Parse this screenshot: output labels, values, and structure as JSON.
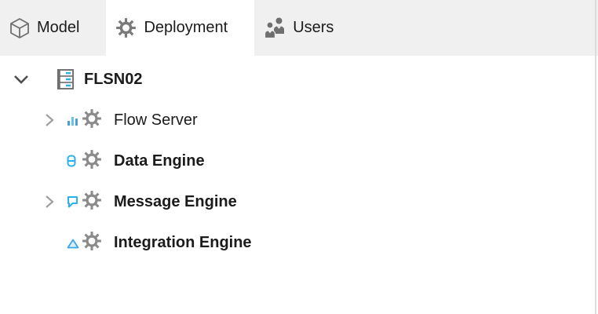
{
  "tab_bar": {
    "tabs": [
      {
        "label": "Model",
        "icon": "cube-icon",
        "active": false
      },
      {
        "label": "Deployment",
        "icon": "gear-icon",
        "active": true
      },
      {
        "label": "Users",
        "icon": "users-icon",
        "active": false
      }
    ]
  },
  "tree": {
    "root": {
      "label": "FLSN02",
      "icon": "server-icon",
      "state": "expanded"
    },
    "children": [
      {
        "label": "Flow Server",
        "icon": "flow-stats-gear-icon",
        "state": "collapsed"
      },
      {
        "label": "Data Engine",
        "icon": "database-gear-icon",
        "state": "leaf"
      },
      {
        "label": "Message Engine",
        "icon": "message-gear-icon",
        "state": "collapsed"
      },
      {
        "label": "Integration Engine",
        "icon": "integration-gear-icon",
        "state": "leaf"
      }
    ]
  },
  "colors": {
    "tab_bar_bg": "#f0f0f0",
    "active_tab_bg": "#ffffff",
    "text": "#1b1b1b",
    "accent_blue": "#2fb0e8",
    "icon_gray": "#6f6f6f",
    "gear_gray": "#848484"
  }
}
